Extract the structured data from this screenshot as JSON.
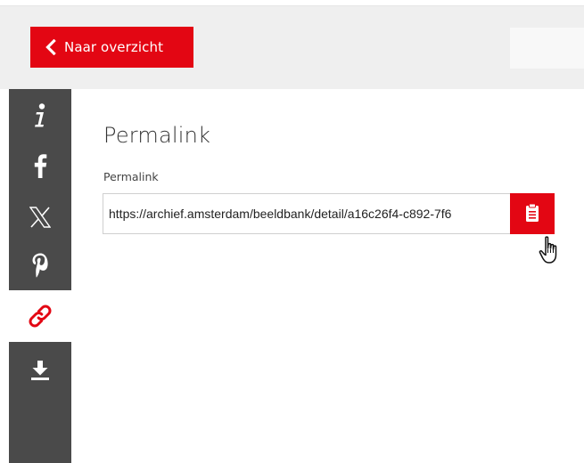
{
  "header": {
    "back_label": "Naar overzicht"
  },
  "sidebar": {
    "items": [
      {
        "name": "info",
        "icon": "info-icon",
        "active": false
      },
      {
        "name": "facebook",
        "icon": "facebook-icon",
        "active": false
      },
      {
        "name": "x",
        "icon": "x-icon",
        "active": false
      },
      {
        "name": "pinterest",
        "icon": "pinterest-icon",
        "active": false
      },
      {
        "name": "permalink",
        "icon": "link-icon",
        "active": true
      },
      {
        "name": "download",
        "icon": "download-icon",
        "active": false
      }
    ]
  },
  "main": {
    "title": "Permalink",
    "field_label": "Permalink",
    "permalink_value": "https://archief.amsterdam/beeldbank/detail/a16c26f4-c892-7f6"
  },
  "colors": {
    "accent": "#e30613",
    "sidebar_bg": "#4a4a4a",
    "header_bg": "#efefef"
  }
}
